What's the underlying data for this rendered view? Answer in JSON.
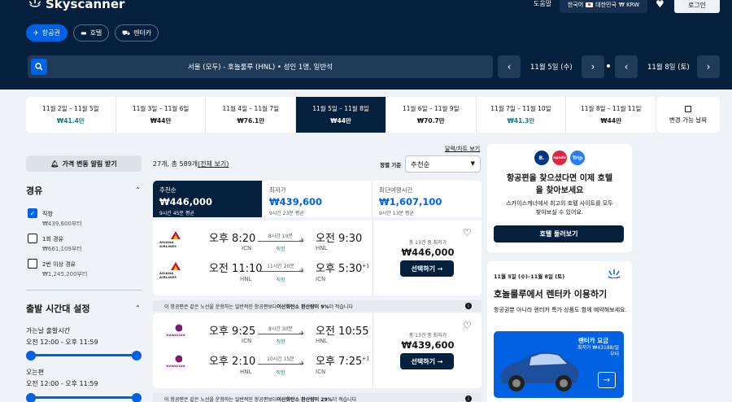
{
  "header": {
    "brand": "Skyscanner",
    "help": "도움말",
    "locale": "한국어",
    "region": "대한민국",
    "currency": "₩ KRW",
    "login": "로그인"
  },
  "product_tabs": [
    {
      "label": "항공권",
      "active": true,
      "icon": "plane-icon"
    },
    {
      "label": "호텔",
      "active": false,
      "icon": "bed-icon"
    },
    {
      "label": "렌터카",
      "active": false,
      "icon": "car-icon"
    }
  ],
  "search": {
    "summary": "서울 (모두) - 호놀룰루 (HNL)  •  성인 1명, 일반석",
    "depart_date": "11월 5일 (수)",
    "return_date": "11월 8일 (토)"
  },
  "date_strip": [
    {
      "range": "11월 2일 – 11월 5일",
      "price": "₩41.4만",
      "green": true,
      "selected": false
    },
    {
      "range": "11월 3일 – 11월 6일",
      "price": "₩44만",
      "green": false,
      "selected": false
    },
    {
      "range": "11월 4일 – 11월 7일",
      "price": "₩76.1만",
      "green": false,
      "selected": false
    },
    {
      "range": "11월 5일 – 11월 8일",
      "price": "₩44만",
      "green": false,
      "selected": true
    },
    {
      "range": "11월 6일 – 11월 9일",
      "price": "₩70.7만",
      "green": false,
      "selected": false
    },
    {
      "range": "11월 7일 – 11월 10일",
      "price": "₩41.3만",
      "green": true,
      "selected": false
    },
    {
      "range": "11월 8일 – 11월 11일",
      "price": "₩44만",
      "green": false,
      "selected": false
    }
  ],
  "flexible_dates": "변경 가능 날짜",
  "filters": {
    "price_alert": "가격 변동 알림 받기",
    "stops_title": "경유",
    "stops": [
      {
        "label": "직항",
        "price": "₩439,600부터",
        "checked": true
      },
      {
        "label": "1회 경유",
        "price": "₩661,109부터",
        "checked": false
      },
      {
        "label": "2번 이상 경유",
        "price": "₩1,245,200부터",
        "checked": false
      }
    ],
    "time_title": "출발 시간대 설정",
    "outbound_label": "가는날 출발시간",
    "outbound_range": "오전 12:00 - 오후 11:59",
    "return_label": "오는편",
    "return_range": "오전 12:00 - 오후 11:59"
  },
  "results": {
    "count_prefix": "27개, 총 589개",
    "count_link": "(전체 보기)",
    "chart_link": "달력/차트 보기",
    "sort_label": "정렬 기준",
    "sort_value": "추천순"
  },
  "sort_tabs": [
    {
      "label": "추천순",
      "price": "₩446,000",
      "sub": "9시간 45분 평균",
      "active": true
    },
    {
      "label": "최저가",
      "price": "₩439,600",
      "sub": "9시간 23분 평균",
      "active": false
    },
    {
      "label": "최단여행시간",
      "price": "₩1,607,100",
      "sub": "9시간 13분 평균",
      "active": false
    }
  ],
  "itineraries": [
    {
      "airline": "ASIANA AIRLINES",
      "out": {
        "dep": "오후 8:20",
        "dep_ap": "ICN",
        "arr": "오전 9:30",
        "arr_ap": "HNL",
        "dur": "8시간 10분",
        "stop": "직항",
        "plus": ""
      },
      "ret": {
        "dep": "오전 11:10",
        "dep_ap": "HNL",
        "arr": "오후 5:30",
        "arr_ap": "ICN",
        "dur": "11시간 20분",
        "stop": "직항",
        "plus": "+1"
      },
      "deals": "총 13건 중 최저가",
      "price": "₩446,000",
      "select": "선택하기 →",
      "eco_pre": "이 항공편은 같은 노선을 운항하는 일반적인 항공편보다 ",
      "eco_bold": "이산화탄소 환산량이 9%",
      "eco_post": " 더 적습니다"
    },
    {
      "airline": "HAWAIIAN",
      "out": {
        "dep": "오후 9:25",
        "dep_ap": "ICN",
        "arr": "오전 10:55",
        "arr_ap": "HNL",
        "dur": "8시간 30분",
        "stop": "직항",
        "plus": ""
      },
      "ret": {
        "dep": "오후 2:10",
        "dep_ap": "HNL",
        "arr": "오후 7:25",
        "arr_ap": "ICN",
        "dur": "10시간 15분",
        "stop": "직항",
        "plus": "+1"
      },
      "deals": "총 13건 중 최저가",
      "price": "₩439,600",
      "select": "선택하기 →",
      "eco_pre": "이 항공편은 같은 노선을 운항하는 일반적인 항공편보다 ",
      "eco_bold": "이산화탄소 환산량이 29%",
      "eco_post": " 더 적습니다"
    }
  ],
  "ad_hotel": {
    "logos": [
      "B.",
      "agoda",
      "Trip"
    ],
    "title_1": "항공편을 찾으셨다면 이제 호텔",
    "title_2": "을 찾아보세요",
    "desc_1": "스카이스캐너에서 최고의 호텔 사이트를 모두",
    "desc_2": "찾아보실 수 있어요.",
    "button": "호텔 둘러보기"
  },
  "ad_car": {
    "dates": "11월 5일 (수)–11월 8일 (토)",
    "title": "호놀룰루에서 렌터카 이용하기",
    "desc": "항공권뿐 아니라 렌터카 특가 상품도 함께 예약해보세요.",
    "box_title": "렌터카 요금",
    "box_sub_1": "최저가 ₩43188/일",
    "box_sub_2": "부터",
    "arrow": "→"
  },
  "colors": {
    "navy": "#05203c",
    "blue": "#0062e3",
    "green": "#0c838a"
  }
}
